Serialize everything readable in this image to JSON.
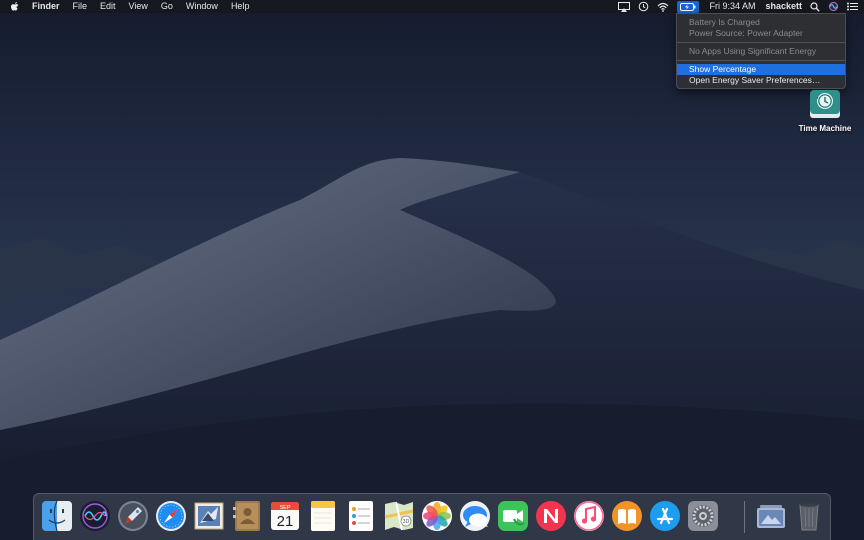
{
  "menubar": {
    "app_name": "Finder",
    "menus": [
      "File",
      "Edit",
      "View",
      "Go",
      "Window",
      "Help"
    ],
    "clock": "Fri 9:34 AM",
    "user": "shackett"
  },
  "battery_menu": {
    "status": "Battery Is Charged",
    "power_source": "Power Source: Power Adapter",
    "energy": "No Apps Using Significant Energy",
    "show_percentage": "Show Percentage",
    "preferences": "Open Energy Saver Preferences…"
  },
  "desktop": {
    "time_machine_label": "Time Machine"
  },
  "dock": {
    "calendar_month": "SEP",
    "calendar_day": "21",
    "apps": [
      "finder-icon",
      "siri-icon",
      "launchpad-icon",
      "safari-icon",
      "mail-icon",
      "contacts-icon",
      "calendar-icon",
      "notes-icon",
      "reminders-icon",
      "maps-icon",
      "photos-icon",
      "messages-icon",
      "facetime-icon",
      "news-icon",
      "music-icon",
      "books-icon",
      "app-store-icon",
      "system-preferences-icon",
      "downloads-stack-icon",
      "trash-icon"
    ]
  },
  "colors": {
    "menu_highlight": "#1f6fde",
    "battery_active": "#1466d6"
  }
}
